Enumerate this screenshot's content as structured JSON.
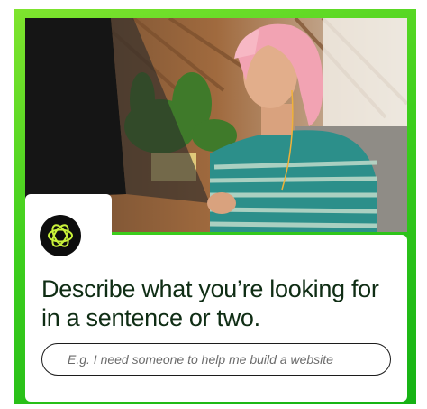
{
  "headline": "Describe what you’re looking for in a sentence or two.",
  "search": {
    "placeholder": "E.g. I need someone to help me build a website"
  },
  "icons": {
    "logo": "flower-logo-icon"
  },
  "colors": {
    "card_gradient_start": "#7fe42e",
    "card_gradient_end": "#14b214",
    "headline": "#0f2d14",
    "logo_bg": "#0d0d0d",
    "logo_fg": "#c9f23a"
  }
}
